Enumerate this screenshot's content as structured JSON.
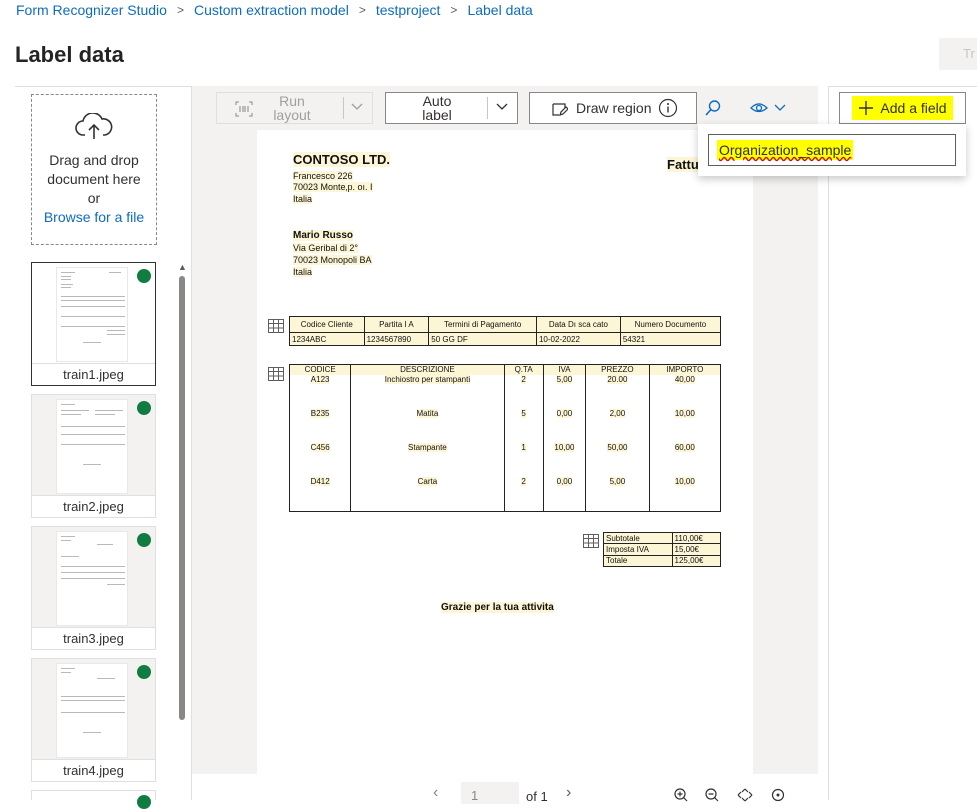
{
  "breadcrumb": [
    "Form Recognizer Studio",
    "Custom extraction model",
    "testproject",
    "Label data"
  ],
  "page_title": "Label data",
  "train_button": "Tr",
  "dropzone": {
    "line1": "Drag and drop",
    "line2": "document here",
    "line3": "or",
    "browse": "Browse for a file"
  },
  "files": [
    "train1.jpeg",
    "train2.jpeg",
    "train3.jpeg",
    "train4.jpeg"
  ],
  "status_color": "#107c41",
  "toolbar": {
    "run_layout_1": "Run",
    "run_layout_2": "layout",
    "auto_label_1": "Auto",
    "auto_label_2": "label",
    "draw_region": "Draw region"
  },
  "add_field": "Add a field",
  "field_input_value": "Organization_sample",
  "pager": {
    "page": "1",
    "of": "of 1"
  },
  "document": {
    "company": "CONTOSO LTD.",
    "addr1": "Francesco 226",
    "addr2": "70023 Monte‚p. oı. I",
    "addr3": "Italia",
    "title": "Fattu",
    "cust_name": "Mario Russo",
    "cust1": "Via Geribal di 2°",
    "cust2": "70023 Monopoli BA",
    "cust3": "Italia",
    "info_headers": [
      "Codice Cliente",
      "Partita I A",
      "Termini di Pagamento",
      "Data Dı sca cato",
      "Numero Documento"
    ],
    "info_values": [
      "1234ABC",
      "1234567890",
      "50 GG DF",
      "10-02-2022",
      "54321"
    ],
    "item_headers": [
      "CODICE",
      "DESCRIZIONE",
      "Q.TA",
      "IVA",
      "PREZZO",
      "IMPORTO"
    ],
    "items": [
      [
        "A123",
        "Inchiostro per stampanti",
        "2",
        "5,00",
        "20.00",
        "40,00"
      ],
      [
        "B235",
        "Matita",
        "5",
        "0,00",
        "2,00",
        "10,00"
      ],
      [
        "C456",
        "Stampante",
        "1",
        "10,00",
        "50,00",
        "60,00"
      ],
      [
        "D412",
        "Carta",
        "2",
        "0,00",
        "5,00",
        "10,00"
      ]
    ],
    "totals": [
      [
        "Subtotale",
        "110,00€"
      ],
      [
        "Imposta IVA",
        "15,00€"
      ],
      [
        "Totale",
        "125,00€"
      ]
    ],
    "footer": "Grazie per la tua attivita"
  }
}
